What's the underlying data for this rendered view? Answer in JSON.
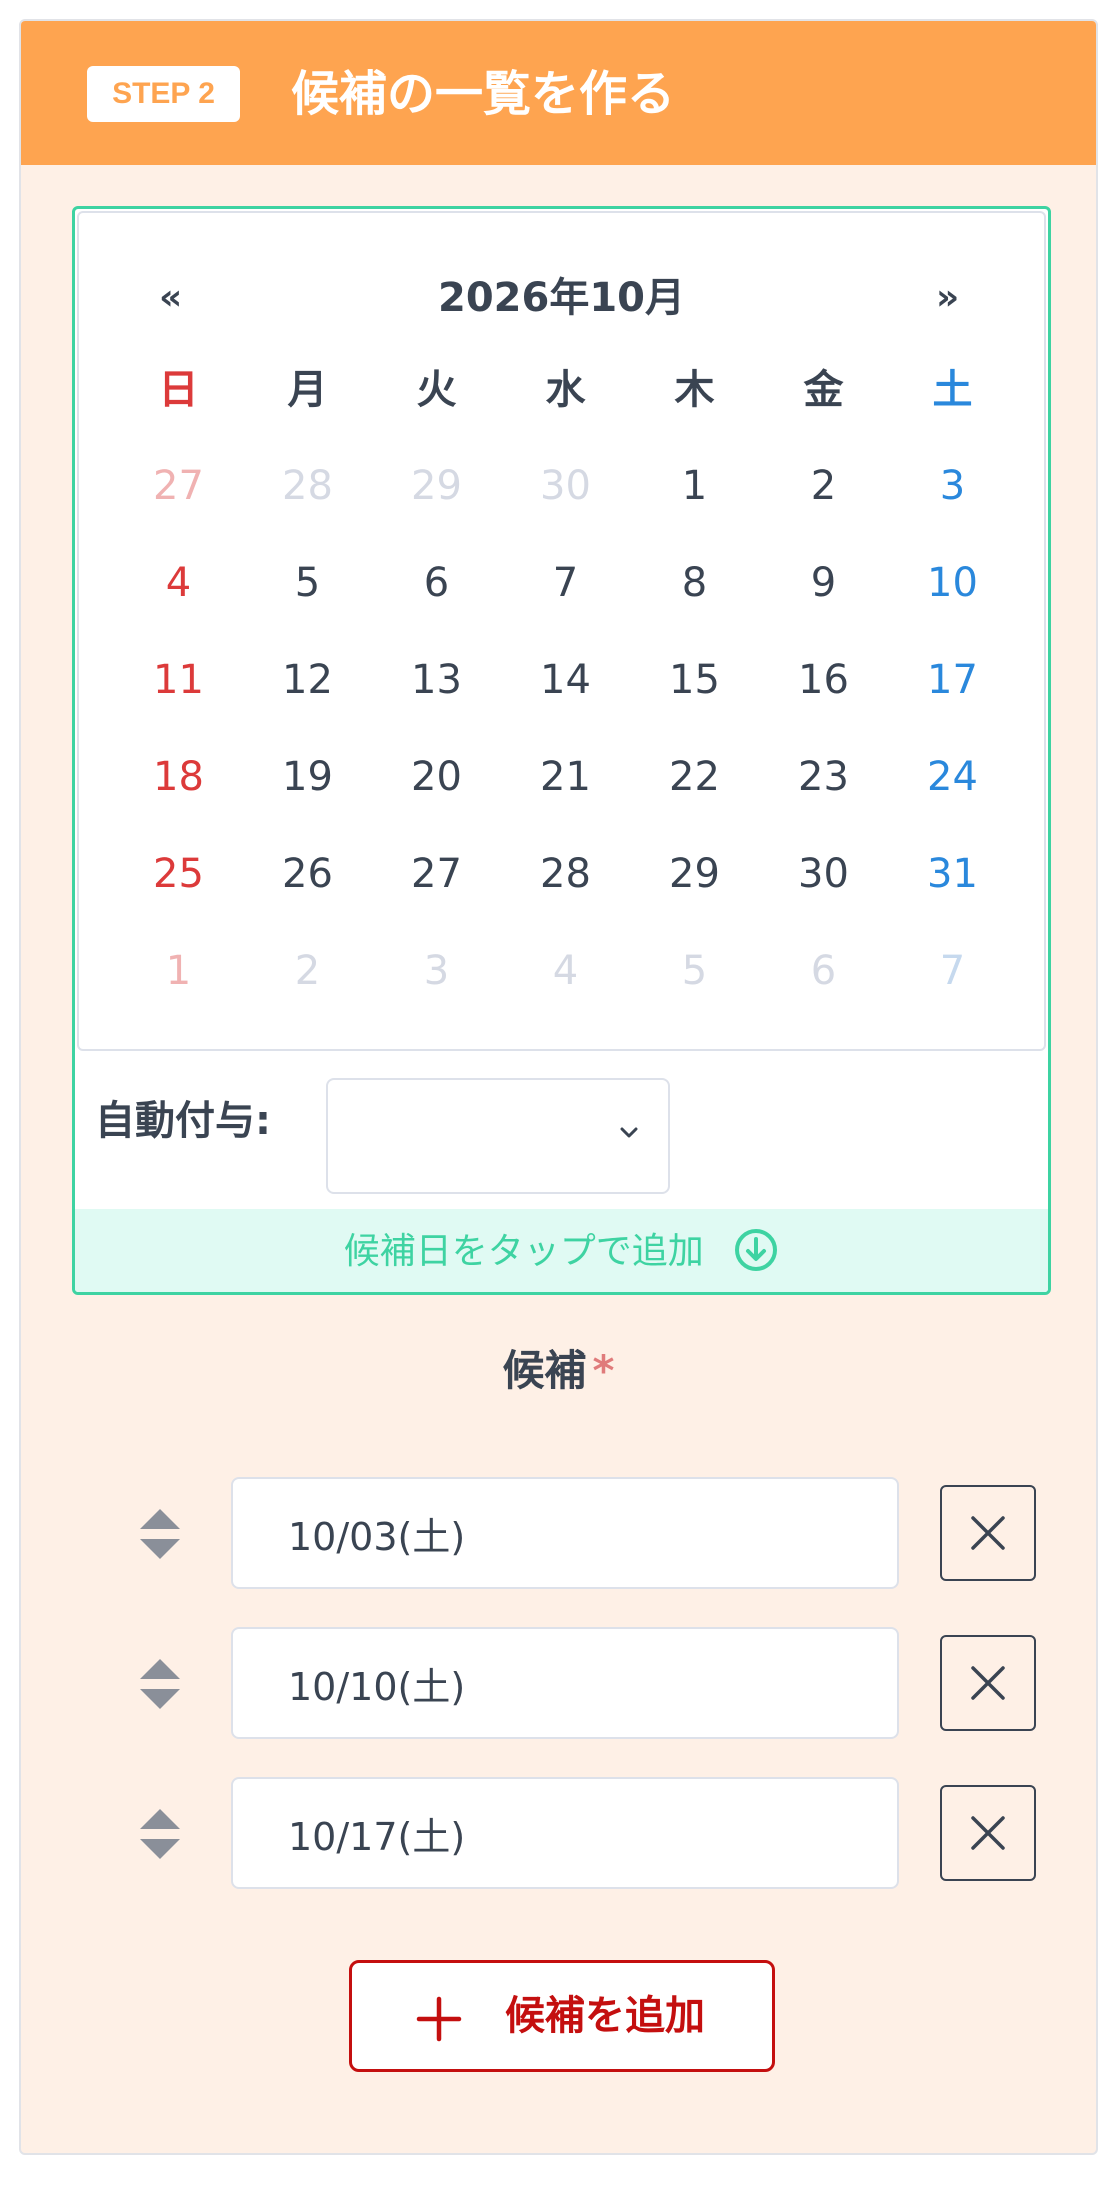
{
  "header": {
    "step_badge": "STEP 2",
    "title": "候補の一覧を作る"
  },
  "calendar": {
    "prev_label": "«",
    "next_label": "»",
    "title": "2026年10月",
    "weekdays": [
      "日",
      "月",
      "火",
      "水",
      "木",
      "金",
      "土"
    ],
    "weeks": [
      [
        "27",
        "28",
        "29",
        "30",
        "1",
        "2",
        "3"
      ],
      [
        "4",
        "5",
        "6",
        "7",
        "8",
        "9",
        "10"
      ],
      [
        "11",
        "12",
        "13",
        "14",
        "15",
        "16",
        "17"
      ],
      [
        "18",
        "19",
        "20",
        "21",
        "22",
        "23",
        "24"
      ],
      [
        "25",
        "26",
        "27",
        "28",
        "29",
        "30",
        "31"
      ],
      [
        "1",
        "2",
        "3",
        "4",
        "5",
        "6",
        "7"
      ]
    ],
    "in_month": [
      [
        false,
        false,
        false,
        false,
        true,
        true,
        true
      ],
      [
        true,
        true,
        true,
        true,
        true,
        true,
        true
      ],
      [
        true,
        true,
        true,
        true,
        true,
        true,
        true
      ],
      [
        true,
        true,
        true,
        true,
        true,
        true,
        true
      ],
      [
        true,
        true,
        true,
        true,
        true,
        true,
        true
      ],
      [
        false,
        false,
        false,
        false,
        false,
        false,
        false
      ]
    ]
  },
  "auto_assign": {
    "label": "自動付与:",
    "selected": ""
  },
  "tap_hint": "候補日をタップで追加",
  "candidates": {
    "label": "候補",
    "required_mark": "*",
    "items": [
      {
        "value": "10/03(土)"
      },
      {
        "value": "10/10(土)"
      },
      {
        "value": "10/17(土)"
      }
    ],
    "add_label": "候補を追加"
  },
  "colors": {
    "header_orange": "#fea450",
    "panel_bg": "#fef0e6",
    "accent_green": "#3ed3a2",
    "sunday_red": "#dc3a3a",
    "saturday_blue": "#2a88dc",
    "add_red": "#c40f0f",
    "text_dark": "#3a4452"
  }
}
